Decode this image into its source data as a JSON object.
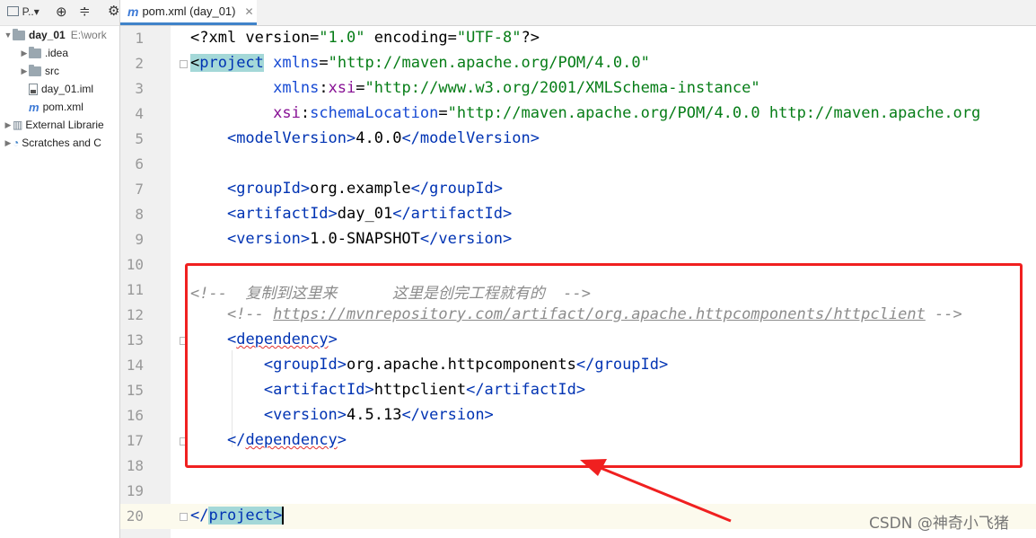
{
  "project_panel": {
    "toolbar_label": "P..▾",
    "tree": [
      {
        "label": "day_01",
        "path": "E:\\work",
        "depth": 0,
        "kind": "folder",
        "expanded": true,
        "bold": true
      },
      {
        "label": ".idea",
        "depth": 1,
        "kind": "folder",
        "expanded": false
      },
      {
        "label": "src",
        "depth": 1,
        "kind": "folder",
        "expanded": false
      },
      {
        "label": "day_01.iml",
        "depth": 1,
        "kind": "file"
      },
      {
        "label": "pom.xml",
        "depth": 1,
        "kind": "maven"
      },
      {
        "label": "External Librarie",
        "depth": 0,
        "kind": "library",
        "expanded": false
      },
      {
        "label": "Scratches and C",
        "depth": 0,
        "kind": "scratch",
        "expanded": false
      }
    ]
  },
  "editor_tab": {
    "label": "pom.xml (day_01)",
    "close": "✕"
  },
  "editor": {
    "current_line": 20,
    "lines": [
      {
        "n": "1",
        "html": "&lt;?xml version=<span class=\"val\">\"1.0\"</span> encoding=<span class=\"val\">\"UTF-8\"</span>?&gt;"
      },
      {
        "n": "2",
        "html": "<span class=\"hl\">&lt;</span><span class=\"tag\"><span class=\"hl\">project</span></span> <span class=\"attr\">xmlns</span>=<span class=\"val\">\"http://maven.apache.org/POM/4.0.0\"</span>"
      },
      {
        "n": "3",
        "html": "         <span class=\"attr\">xmlns</span>:<span class=\"ns\">xsi</span>=<span class=\"val\">\"http://www.w3.org/2001/XMLSchema-instance\"</span>"
      },
      {
        "n": "4",
        "html": "         <span class=\"ns\">xsi</span>:<span class=\"attr\">schemaLocation</span>=<span class=\"val\">\"http://maven.apache.org/POM/4.0.0 http://maven.apache.org</span>"
      },
      {
        "n": "5",
        "html": "    <span class=\"tag\">&lt;modelVersion&gt;</span>4.0.0<span class=\"tag\">&lt;/modelVersion&gt;</span>"
      },
      {
        "n": "6",
        "html": ""
      },
      {
        "n": "7",
        "html": "    <span class=\"tag\">&lt;groupId&gt;</span>org.example<span class=\"tag\">&lt;/groupId&gt;</span>"
      },
      {
        "n": "8",
        "html": "    <span class=\"tag\">&lt;artifactId&gt;</span>day_01<span class=\"tag\">&lt;/artifactId&gt;</span>"
      },
      {
        "n": "9",
        "html": "    <span class=\"tag\">&lt;version&gt;</span>1.0-SNAPSHOT<span class=\"tag\">&lt;/version&gt;</span>"
      },
      {
        "n": "10",
        "html": ""
      },
      {
        "n": "11",
        "html": "<span class=\"cmt\">&lt;!--  复制到这里来      这里是创完工程就有的  --&gt;</span>"
      },
      {
        "n": "12",
        "html": "    <span class=\"cmt\">&lt;!-- <span class=\"link\">https://mvnrepository.com/artifact/org.apache.httpcomponents/httpclient</span> --&gt;</span>"
      },
      {
        "n": "13",
        "html": "    <span class=\"tag\">&lt;<span class=\"squig\">dependency</span>&gt;</span>"
      },
      {
        "n": "14",
        "html": "        <span class=\"tag\">&lt;groupId&gt;</span>org.apache.httpcomponents<span class=\"tag\">&lt;/groupId&gt;</span>"
      },
      {
        "n": "15",
        "html": "        <span class=\"tag\">&lt;artifactId&gt;</span>httpclient<span class=\"tag\">&lt;/artifactId&gt;</span>"
      },
      {
        "n": "16",
        "html": "        <span class=\"tag\">&lt;version&gt;</span>4.5.13<span class=\"tag\">&lt;/version&gt;</span>"
      },
      {
        "n": "17",
        "html": "    <span class=\"tag\">&lt;/<span class=\"squig\">dependency</span>&gt;</span>"
      },
      {
        "n": "18",
        "html": ""
      },
      {
        "n": "19",
        "html": ""
      },
      {
        "n": "20",
        "html": "<span class=\"tag\">&lt;/<span class=\"hl\">project</span><span class=\"hl caret\">&gt;</span></span>"
      }
    ]
  },
  "watermark": "CSDN @神奇小飞猪",
  "colors": {
    "annotation_red": "#f02020",
    "tag_blue": "#0033b3",
    "string_green": "#067d17"
  }
}
